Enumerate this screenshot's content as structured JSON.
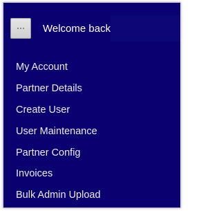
{
  "header": {
    "welcome_text": "Welcome back,"
  },
  "menu": {
    "items": [
      {
        "label": "My Account"
      },
      {
        "label": "Partner Details"
      },
      {
        "label": "Create User"
      },
      {
        "label": "User Maintenance"
      },
      {
        "label": "Partner Config"
      },
      {
        "label": "Invoices"
      },
      {
        "label": "Bulk Admin Upload"
      }
    ]
  },
  "colors": {
    "panel_background": "#0a0070",
    "text": "#ececf6"
  },
  "icons": {
    "avatar": "broken-image-avatar-icon"
  }
}
